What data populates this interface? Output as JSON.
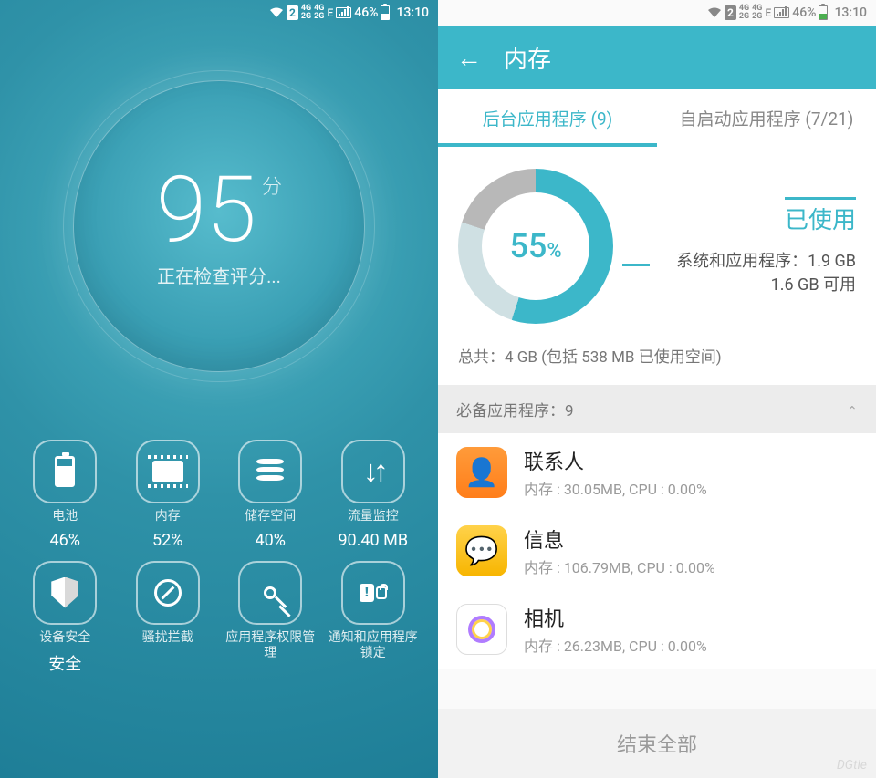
{
  "status": {
    "sim_badge": "2",
    "net1": "4G",
    "net1b": "2G",
    "net2": "4G",
    "net2b": "2G",
    "edge": "E",
    "battery_pct": "46%",
    "time": "13:10"
  },
  "left": {
    "score": "95",
    "score_unit": "分",
    "score_sub": "正在检查评分...",
    "tiles": [
      {
        "icon": "battery",
        "label": "电池",
        "value": "46%"
      },
      {
        "icon": "chip",
        "label": "内存",
        "value": "52%"
      },
      {
        "icon": "db",
        "label": "储存空间",
        "value": "40%"
      },
      {
        "icon": "net",
        "label": "流量监控",
        "value": "90.40 MB"
      },
      {
        "icon": "shield",
        "label": "设备安全",
        "value": "安全"
      },
      {
        "icon": "block",
        "label": "骚扰拦截",
        "value": ""
      },
      {
        "icon": "key",
        "label": "应用程序权限管\n理",
        "value": ""
      },
      {
        "icon": "bell",
        "label": "通知和应用程序\n锁定",
        "value": ""
      }
    ]
  },
  "right": {
    "title": "内存",
    "tabs": {
      "active": "后台应用程序 (9)",
      "inactive": "自启动应用程序 (7/21)"
    },
    "donut": {
      "percent": "55",
      "percent_sym": "%",
      "used_label": "已使用",
      "sys_line": "系统和应用程序：1.9 GB",
      "avail_line": "1.6 GB 可用"
    },
    "total_line": "总共：4 GB (包括 538 MB 已使用空间)",
    "section_header": "必备应用程序：9",
    "apps": [
      {
        "icon": "contacts",
        "name": "联系人",
        "sub": "内存 : 30.05MB, CPU : 0.00%"
      },
      {
        "icon": "messages",
        "name": "信息",
        "sub": "内存 : 106.79MB, CPU : 0.00%"
      },
      {
        "icon": "camera",
        "name": "相机",
        "sub": "内存 : 26.23MB, CPU : 0.00%"
      }
    ],
    "footer_btn": "结束全部"
  },
  "chart_data": {
    "type": "pie",
    "title": "内存 已使用",
    "series": [
      {
        "name": "已使用 (系统和应用程序)",
        "value_gb": 1.9,
        "percent": 55
      },
      {
        "name": "可用",
        "value_gb": 1.6
      }
    ],
    "total_gb": 4,
    "reserved_mb": 538
  },
  "watermark": "DGtle"
}
